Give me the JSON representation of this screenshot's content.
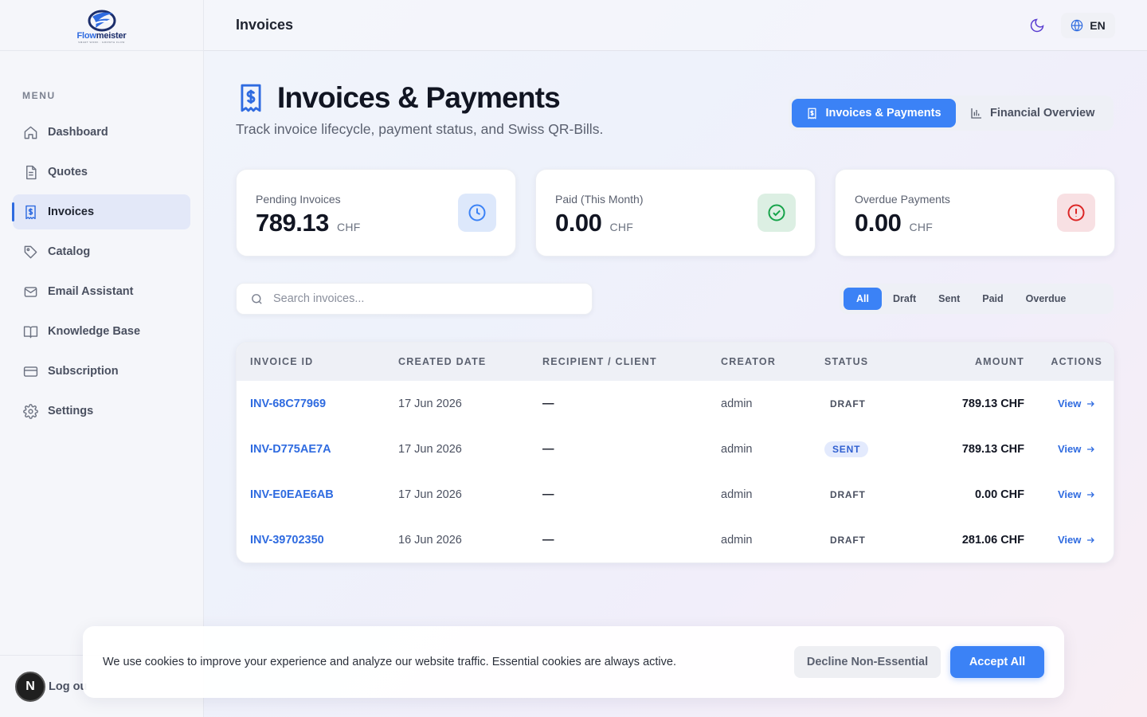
{
  "brand": {
    "name_part1": "Flow",
    "name_part2": "meister",
    "tagline": "SMART WORK · GROWTH FLOW"
  },
  "sidebar": {
    "menu_label": "MENU",
    "items": [
      {
        "label": "Dashboard",
        "icon": "home-icon"
      },
      {
        "label": "Quotes",
        "icon": "document-icon"
      },
      {
        "label": "Invoices",
        "icon": "invoice-icon",
        "active": true
      },
      {
        "label": "Catalog",
        "icon": "tag-icon"
      },
      {
        "label": "Email Assistant",
        "icon": "mail-icon"
      },
      {
        "label": "Knowledge Base",
        "icon": "book-icon"
      },
      {
        "label": "Subscription",
        "icon": "card-icon"
      },
      {
        "label": "Settings",
        "icon": "gear-icon"
      }
    ],
    "avatar_letter": "N",
    "logout_label": "Log ou"
  },
  "topbar": {
    "title": "Invoices",
    "language": "EN"
  },
  "header": {
    "title": "Invoices & Payments",
    "subtitle": "Track invoice lifecycle, payment status, and Swiss QR-Bills.",
    "tabs": [
      {
        "label": "Invoices & Payments",
        "active": true
      },
      {
        "label": "Financial Overview",
        "active": false
      }
    ]
  },
  "stats": [
    {
      "label": "Pending Invoices",
      "value": "789.13",
      "currency": "CHF",
      "icon": "clock-icon",
      "color": "#3b82f6"
    },
    {
      "label": "Paid (This Month)",
      "value": "0.00",
      "currency": "CHF",
      "icon": "check-circle-icon",
      "color": "#16a34a"
    },
    {
      "label": "Overdue Payments",
      "value": "0.00",
      "currency": "CHF",
      "icon": "alert-circle-icon",
      "color": "#dc2626"
    }
  ],
  "search": {
    "placeholder": "Search invoices...",
    "value": ""
  },
  "filters": [
    {
      "label": "All",
      "active": true
    },
    {
      "label": "Draft"
    },
    {
      "label": "Sent"
    },
    {
      "label": "Paid"
    },
    {
      "label": "Overdue"
    }
  ],
  "table": {
    "columns": [
      "INVOICE ID",
      "CREATED DATE",
      "RECIPIENT / CLIENT",
      "CREATOR",
      "STATUS",
      "AMOUNT",
      "ACTIONS"
    ],
    "rows": [
      {
        "id": "INV-68C77969",
        "date": "17 Jun 2026",
        "client": "—",
        "creator": "admin",
        "status": "DRAFT",
        "amount": "789.13 CHF",
        "action": "View"
      },
      {
        "id": "INV-D775AE7A",
        "date": "17 Jun 2026",
        "client": "—",
        "creator": "admin",
        "status": "SENT",
        "amount": "789.13 CHF",
        "action": "View"
      },
      {
        "id": "INV-E0EAE6AB",
        "date": "17 Jun 2026",
        "client": "—",
        "creator": "admin",
        "status": "DRAFT",
        "amount": "0.00 CHF",
        "action": "View"
      },
      {
        "id": "INV-39702350",
        "date": "16 Jun 2026",
        "client": "—",
        "creator": "admin",
        "status": "DRAFT",
        "amount": "281.06 CHF",
        "action": "View"
      }
    ]
  },
  "cookie": {
    "text": "We use cookies to improve your experience and analyze our website traffic. Essential cookies are always active.",
    "decline_label": "Decline Non-Essential",
    "accept_label": "Accept All"
  },
  "colors": {
    "accent": "#3b82f6",
    "link": "#2f6be0"
  }
}
